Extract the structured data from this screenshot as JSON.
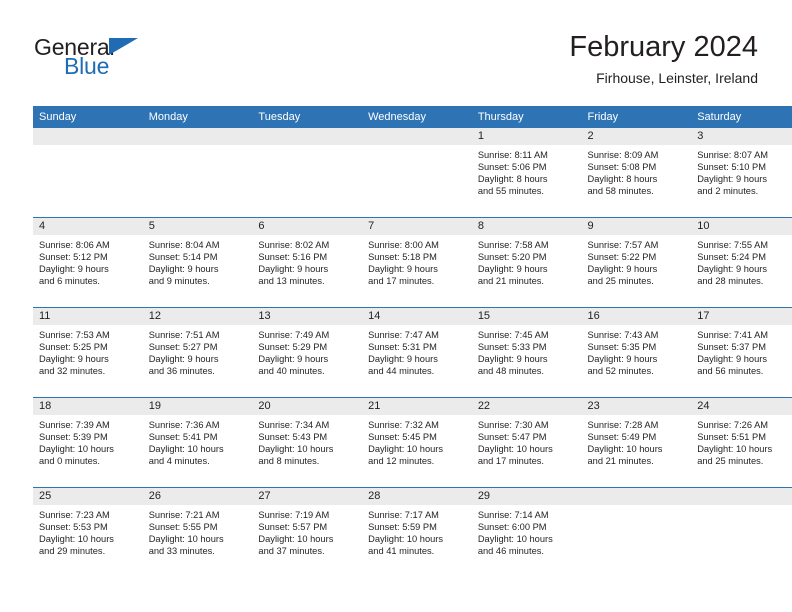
{
  "logo": {
    "word_one": "General",
    "word_two": "Blue",
    "accent_color": "#1f6cb4",
    "triangle_icon": "triangle-icon"
  },
  "header": {
    "title": "February 2024",
    "subtitle": "Firhouse, Leinster, Ireland"
  },
  "calendar": {
    "header_bg": "#2e74b5",
    "daynum_band_bg": "#ebebeb",
    "weekday_headers": [
      "Sunday",
      "Monday",
      "Tuesday",
      "Wednesday",
      "Thursday",
      "Friday",
      "Saturday"
    ],
    "weeks": [
      [
        {
          "day": "",
          "sunrise": "",
          "sunset": "",
          "daylight_1": "",
          "daylight_2": ""
        },
        {
          "day": "",
          "sunrise": "",
          "sunset": "",
          "daylight_1": "",
          "daylight_2": ""
        },
        {
          "day": "",
          "sunrise": "",
          "sunset": "",
          "daylight_1": "",
          "daylight_2": ""
        },
        {
          "day": "",
          "sunrise": "",
          "sunset": "",
          "daylight_1": "",
          "daylight_2": ""
        },
        {
          "day": "1",
          "sunrise": "Sunrise: 8:11 AM",
          "sunset": "Sunset: 5:06 PM",
          "daylight_1": "Daylight: 8 hours",
          "daylight_2": "and 55 minutes."
        },
        {
          "day": "2",
          "sunrise": "Sunrise: 8:09 AM",
          "sunset": "Sunset: 5:08 PM",
          "daylight_1": "Daylight: 8 hours",
          "daylight_2": "and 58 minutes."
        },
        {
          "day": "3",
          "sunrise": "Sunrise: 8:07 AM",
          "sunset": "Sunset: 5:10 PM",
          "daylight_1": "Daylight: 9 hours",
          "daylight_2": "and 2 minutes."
        }
      ],
      [
        {
          "day": "4",
          "sunrise": "Sunrise: 8:06 AM",
          "sunset": "Sunset: 5:12 PM",
          "daylight_1": "Daylight: 9 hours",
          "daylight_2": "and 6 minutes."
        },
        {
          "day": "5",
          "sunrise": "Sunrise: 8:04 AM",
          "sunset": "Sunset: 5:14 PM",
          "daylight_1": "Daylight: 9 hours",
          "daylight_2": "and 9 minutes."
        },
        {
          "day": "6",
          "sunrise": "Sunrise: 8:02 AM",
          "sunset": "Sunset: 5:16 PM",
          "daylight_1": "Daylight: 9 hours",
          "daylight_2": "and 13 minutes."
        },
        {
          "day": "7",
          "sunrise": "Sunrise: 8:00 AM",
          "sunset": "Sunset: 5:18 PM",
          "daylight_1": "Daylight: 9 hours",
          "daylight_2": "and 17 minutes."
        },
        {
          "day": "8",
          "sunrise": "Sunrise: 7:58 AM",
          "sunset": "Sunset: 5:20 PM",
          "daylight_1": "Daylight: 9 hours",
          "daylight_2": "and 21 minutes."
        },
        {
          "day": "9",
          "sunrise": "Sunrise: 7:57 AM",
          "sunset": "Sunset: 5:22 PM",
          "daylight_1": "Daylight: 9 hours",
          "daylight_2": "and 25 minutes."
        },
        {
          "day": "10",
          "sunrise": "Sunrise: 7:55 AM",
          "sunset": "Sunset: 5:24 PM",
          "daylight_1": "Daylight: 9 hours",
          "daylight_2": "and 28 minutes."
        }
      ],
      [
        {
          "day": "11",
          "sunrise": "Sunrise: 7:53 AM",
          "sunset": "Sunset: 5:25 PM",
          "daylight_1": "Daylight: 9 hours",
          "daylight_2": "and 32 minutes."
        },
        {
          "day": "12",
          "sunrise": "Sunrise: 7:51 AM",
          "sunset": "Sunset: 5:27 PM",
          "daylight_1": "Daylight: 9 hours",
          "daylight_2": "and 36 minutes."
        },
        {
          "day": "13",
          "sunrise": "Sunrise: 7:49 AM",
          "sunset": "Sunset: 5:29 PM",
          "daylight_1": "Daylight: 9 hours",
          "daylight_2": "and 40 minutes."
        },
        {
          "day": "14",
          "sunrise": "Sunrise: 7:47 AM",
          "sunset": "Sunset: 5:31 PM",
          "daylight_1": "Daylight: 9 hours",
          "daylight_2": "and 44 minutes."
        },
        {
          "day": "15",
          "sunrise": "Sunrise: 7:45 AM",
          "sunset": "Sunset: 5:33 PM",
          "daylight_1": "Daylight: 9 hours",
          "daylight_2": "and 48 minutes."
        },
        {
          "day": "16",
          "sunrise": "Sunrise: 7:43 AM",
          "sunset": "Sunset: 5:35 PM",
          "daylight_1": "Daylight: 9 hours",
          "daylight_2": "and 52 minutes."
        },
        {
          "day": "17",
          "sunrise": "Sunrise: 7:41 AM",
          "sunset": "Sunset: 5:37 PM",
          "daylight_1": "Daylight: 9 hours",
          "daylight_2": "and 56 minutes."
        }
      ],
      [
        {
          "day": "18",
          "sunrise": "Sunrise: 7:39 AM",
          "sunset": "Sunset: 5:39 PM",
          "daylight_1": "Daylight: 10 hours",
          "daylight_2": "and 0 minutes."
        },
        {
          "day": "19",
          "sunrise": "Sunrise: 7:36 AM",
          "sunset": "Sunset: 5:41 PM",
          "daylight_1": "Daylight: 10 hours",
          "daylight_2": "and 4 minutes."
        },
        {
          "day": "20",
          "sunrise": "Sunrise: 7:34 AM",
          "sunset": "Sunset: 5:43 PM",
          "daylight_1": "Daylight: 10 hours",
          "daylight_2": "and 8 minutes."
        },
        {
          "day": "21",
          "sunrise": "Sunrise: 7:32 AM",
          "sunset": "Sunset: 5:45 PM",
          "daylight_1": "Daylight: 10 hours",
          "daylight_2": "and 12 minutes."
        },
        {
          "day": "22",
          "sunrise": "Sunrise: 7:30 AM",
          "sunset": "Sunset: 5:47 PM",
          "daylight_1": "Daylight: 10 hours",
          "daylight_2": "and 17 minutes."
        },
        {
          "day": "23",
          "sunrise": "Sunrise: 7:28 AM",
          "sunset": "Sunset: 5:49 PM",
          "daylight_1": "Daylight: 10 hours",
          "daylight_2": "and 21 minutes."
        },
        {
          "day": "24",
          "sunrise": "Sunrise: 7:26 AM",
          "sunset": "Sunset: 5:51 PM",
          "daylight_1": "Daylight: 10 hours",
          "daylight_2": "and 25 minutes."
        }
      ],
      [
        {
          "day": "25",
          "sunrise": "Sunrise: 7:23 AM",
          "sunset": "Sunset: 5:53 PM",
          "daylight_1": "Daylight: 10 hours",
          "daylight_2": "and 29 minutes."
        },
        {
          "day": "26",
          "sunrise": "Sunrise: 7:21 AM",
          "sunset": "Sunset: 5:55 PM",
          "daylight_1": "Daylight: 10 hours",
          "daylight_2": "and 33 minutes."
        },
        {
          "day": "27",
          "sunrise": "Sunrise: 7:19 AM",
          "sunset": "Sunset: 5:57 PM",
          "daylight_1": "Daylight: 10 hours",
          "daylight_2": "and 37 minutes."
        },
        {
          "day": "28",
          "sunrise": "Sunrise: 7:17 AM",
          "sunset": "Sunset: 5:59 PM",
          "daylight_1": "Daylight: 10 hours",
          "daylight_2": "and 41 minutes."
        },
        {
          "day": "29",
          "sunrise": "Sunrise: 7:14 AM",
          "sunset": "Sunset: 6:00 PM",
          "daylight_1": "Daylight: 10 hours",
          "daylight_2": "and 46 minutes."
        },
        {
          "day": "",
          "sunrise": "",
          "sunset": "",
          "daylight_1": "",
          "daylight_2": ""
        },
        {
          "day": "",
          "sunrise": "",
          "sunset": "",
          "daylight_1": "",
          "daylight_2": ""
        }
      ]
    ]
  }
}
